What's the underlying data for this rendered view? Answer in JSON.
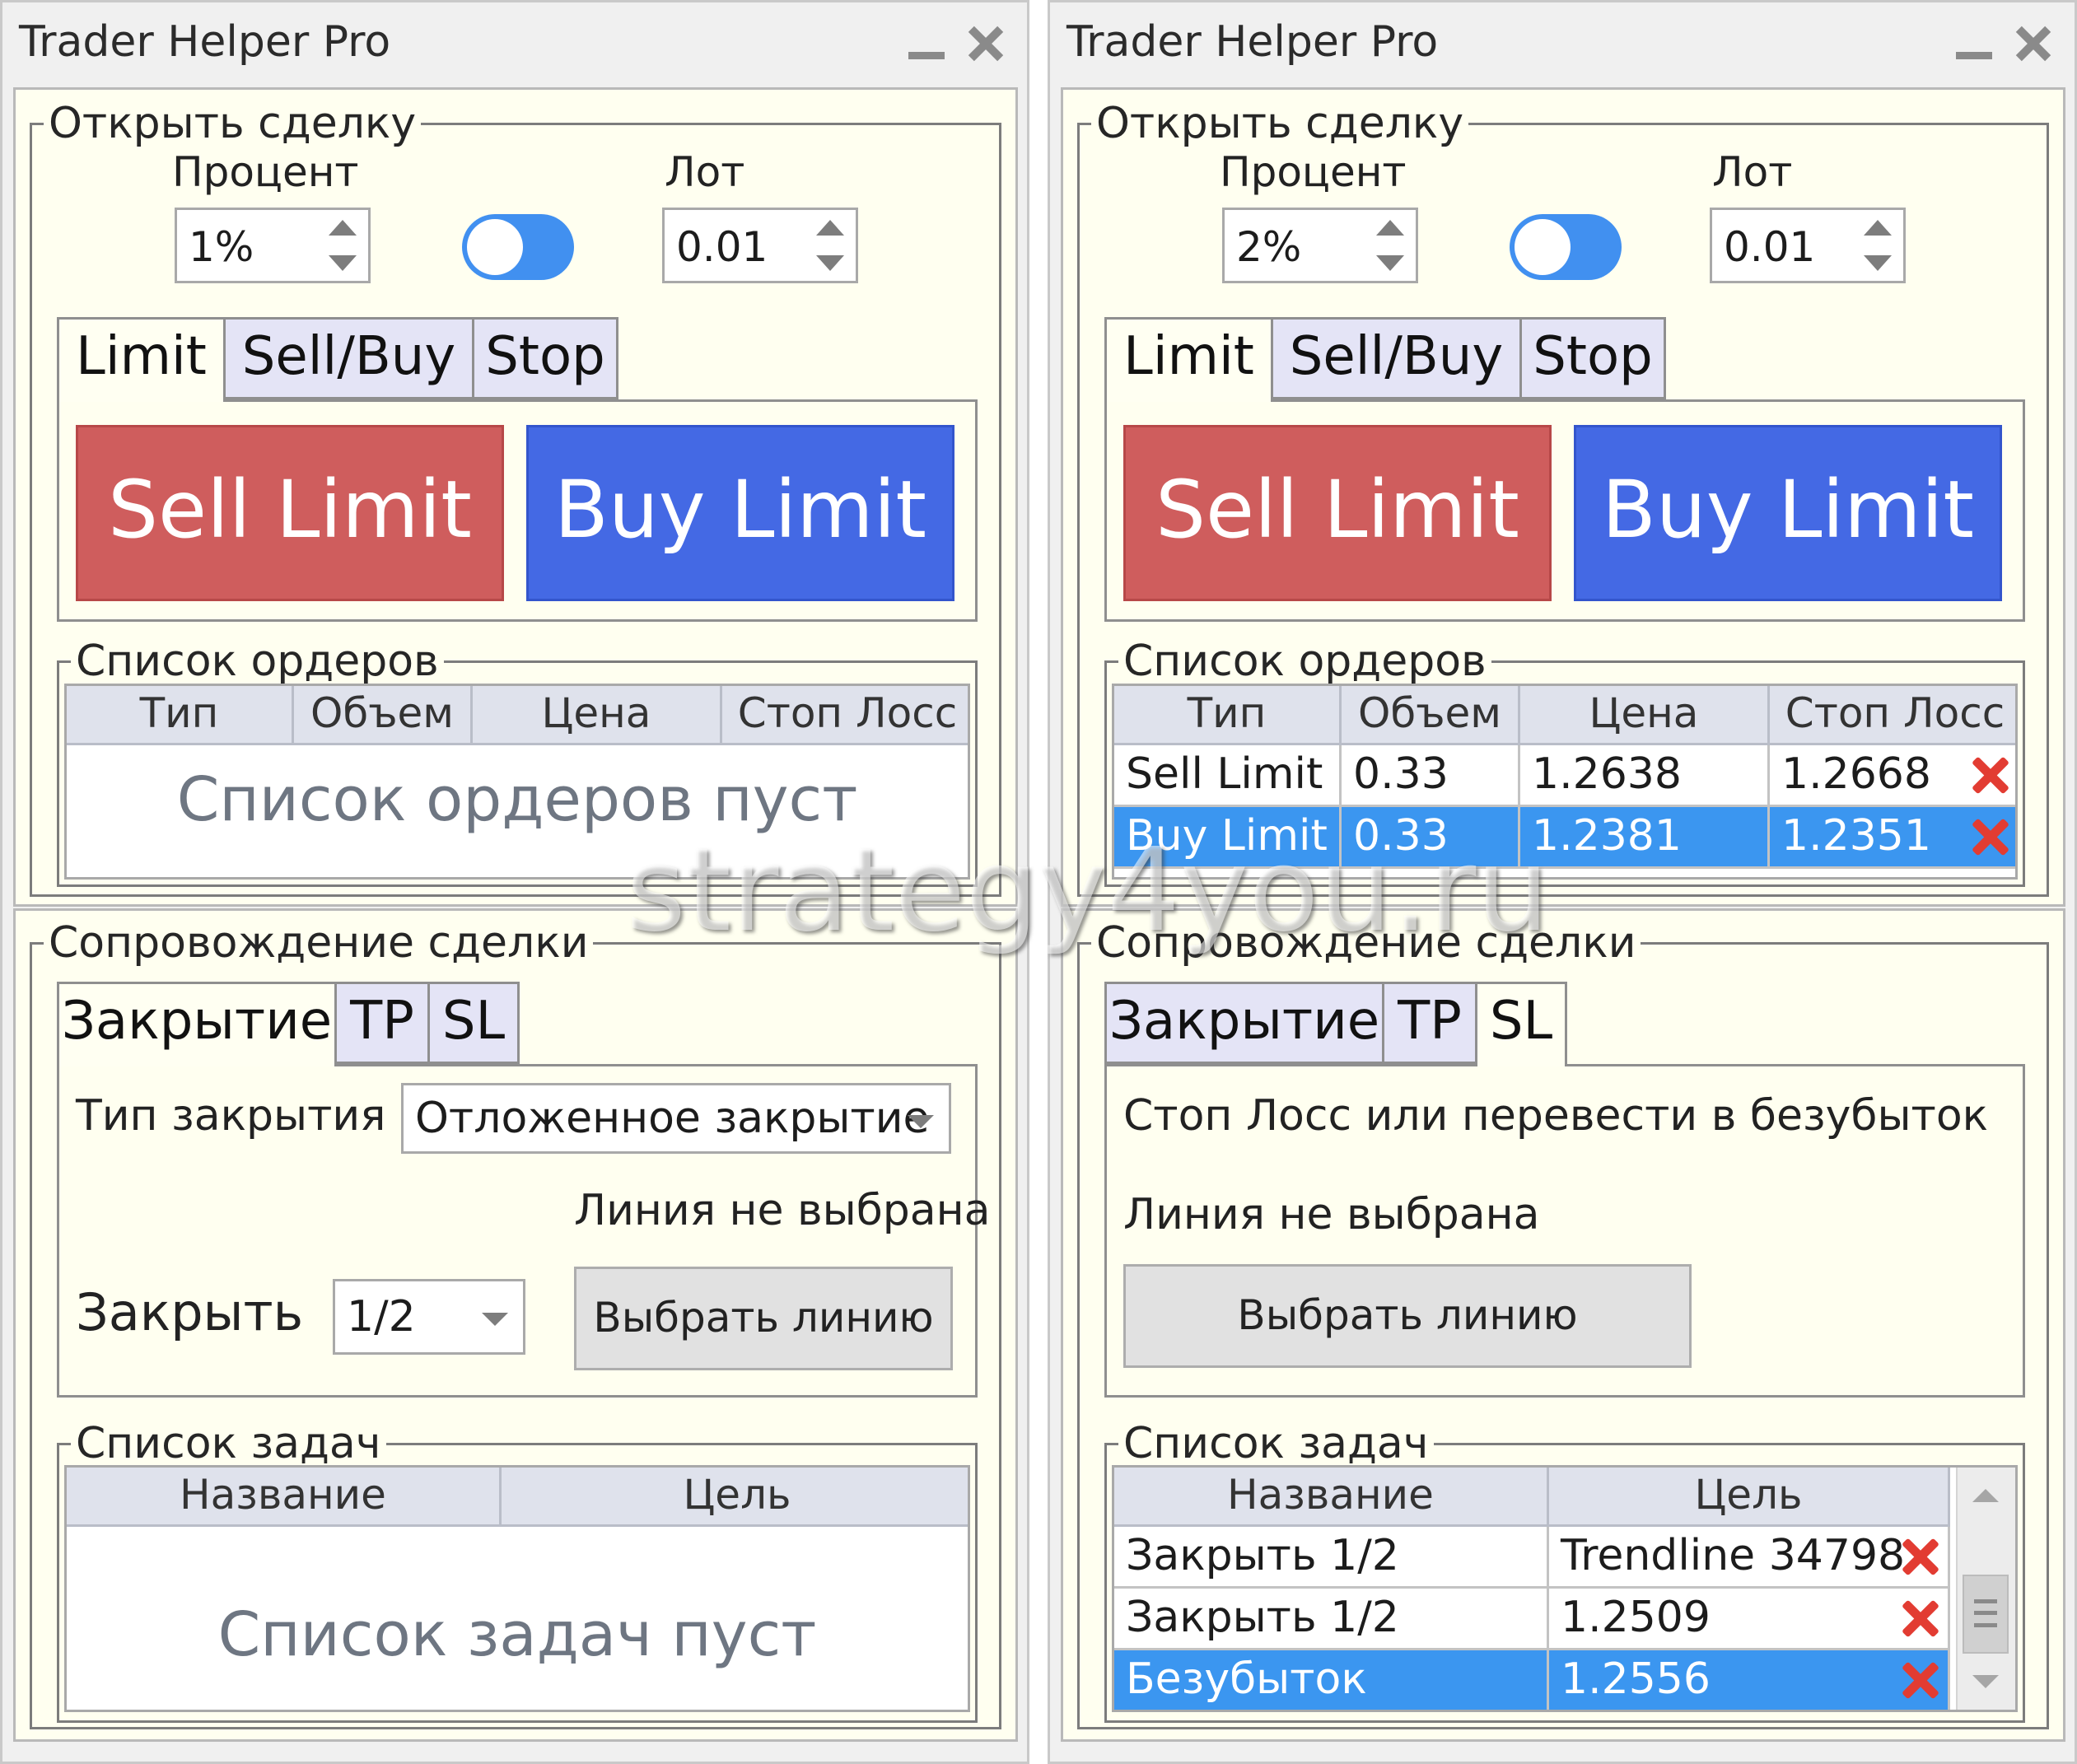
{
  "watermark": "strategy4you.ru",
  "colors": {
    "sell": "#cf5d5d",
    "buy": "#4469e4",
    "selected_row": "#3b96f0",
    "panel_bg": "#fffff0",
    "toggle": "#4190f0",
    "delete_icon": "#e23c32"
  },
  "left": {
    "title": "Trader Helper Pro",
    "open_trade": {
      "legend": "Открыть сделку",
      "percent_label": "Процент",
      "percent_value": "1%",
      "lot_label": "Лот",
      "lot_value": "0.01",
      "tabs": [
        "Limit",
        "Sell/Buy",
        "Stop"
      ],
      "active_tab": "Limit",
      "sell_button": "Sell Limit",
      "buy_button": "Buy Limit"
    },
    "orders": {
      "legend": "Список ордеров",
      "columns": [
        "Тип",
        "Объем",
        "Цена",
        "Стоп Лосс"
      ],
      "empty_text": "Список ордеров пуст"
    },
    "manage": {
      "legend": "Сопровождение сделки",
      "tabs": [
        "Закрытие",
        "TP",
        "SL"
      ],
      "active_tab": "Закрытие",
      "close_type_label": "Тип закрытия",
      "close_type_value": "Отложенное закрытие",
      "line_status": "Линия не выбрана",
      "close_label": "Закрыть",
      "close_value": "1/2",
      "select_line_button": "Выбрать линию"
    },
    "tasks": {
      "legend": "Список задач",
      "columns": [
        "Название",
        "Цель"
      ],
      "empty_text": "Список задач пуст"
    }
  },
  "right": {
    "title": "Trader Helper Pro",
    "open_trade": {
      "legend": "Открыть сделку",
      "percent_label": "Процент",
      "percent_value": "2%",
      "lot_label": "Лот",
      "lot_value": "0.01",
      "tabs": [
        "Limit",
        "Sell/Buy",
        "Stop"
      ],
      "active_tab": "Limit",
      "sell_button": "Sell Limit",
      "buy_button": "Buy Limit"
    },
    "orders": {
      "legend": "Список ордеров",
      "columns": [
        "Тип",
        "Объем",
        "Цена",
        "Стоп Лосс"
      ],
      "rows": [
        {
          "type": "Sell Limit",
          "volume": "0.33",
          "price": "1.2638",
          "stop_loss": "1.2668",
          "selected": false
        },
        {
          "type": "Buy Limit",
          "volume": "0.33",
          "price": "1.2381",
          "stop_loss": "1.2351",
          "selected": true
        }
      ]
    },
    "manage": {
      "legend": "Сопровождение сделки",
      "tabs": [
        "Закрытие",
        "TP",
        "SL"
      ],
      "active_tab": "SL",
      "sl_text": "Стоп Лосс или перевести в безубыток",
      "line_status": "Линия не выбрана",
      "select_line_button": "Выбрать линию"
    },
    "tasks": {
      "legend": "Список задач",
      "columns": [
        "Название",
        "Цель"
      ],
      "rows": [
        {
          "name": "Закрыть 1/2",
          "target": "Trendline 34798",
          "selected": false
        },
        {
          "name": "Закрыть 1/2",
          "target": "1.2509",
          "selected": false
        },
        {
          "name": "Безубыток",
          "target": "1.2556",
          "selected": true
        }
      ]
    }
  }
}
